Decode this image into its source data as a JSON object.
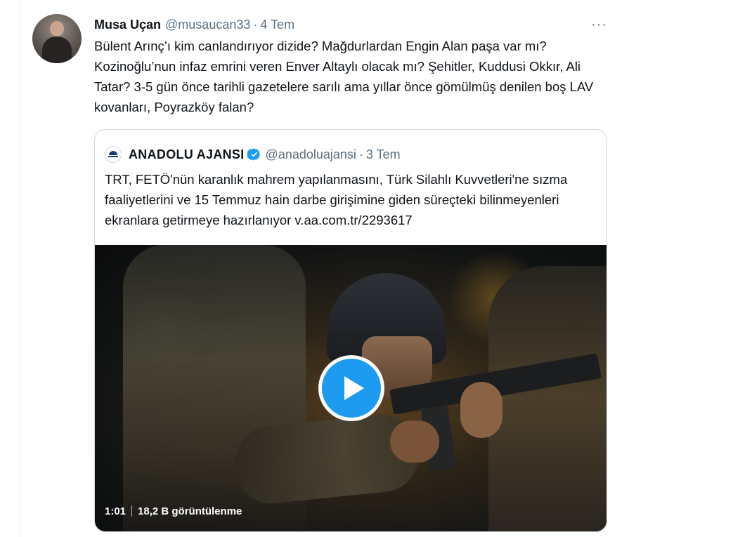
{
  "tweet": {
    "author_name": "Musa Uçan",
    "handle": "@musaucan33",
    "separator": "·",
    "date": "4 Tem",
    "more_label": "···",
    "text": "Bülent Arınç’ı kim canlandırıyor dizide? Mağdurlardan Engin Alan paşa var mı? Kozinoğlu’nun infaz emrini veren Enver Altaylı olacak mı? Şehitler, Kuddusi Okkır, Ali Tatar? 3-5 gün önce tarihli gazetelere sarılı ama yıllar önce gömülmüş denilen boş LAV kovanları, Poyrazköy falan?"
  },
  "quoted": {
    "author_name": "ANADOLU AJANSI",
    "handle": "@anadoluajansi",
    "separator": "·",
    "date": "3 Tem",
    "text": "TRT, FETÖ'nün karanlık mahrem yapılanmasını, Türk Silahlı Kuvvetleri'ne sızma faaliyetlerini ve 15 Temmuz hain darbe girişimine giden süreçteki bilinmeyenleri ekranlara getirmeye hazırlanıyor v.aa.com.tr/2293617",
    "media": {
      "duration": "1:01",
      "views": "18,2 B görüntülenme"
    }
  },
  "colors": {
    "accent": "#1d9bf0",
    "secondary_text": "#5b7083",
    "border": "#cfd9de"
  },
  "icons": [
    "more-icon",
    "verified-icon",
    "play-icon",
    "aa-logo"
  ]
}
